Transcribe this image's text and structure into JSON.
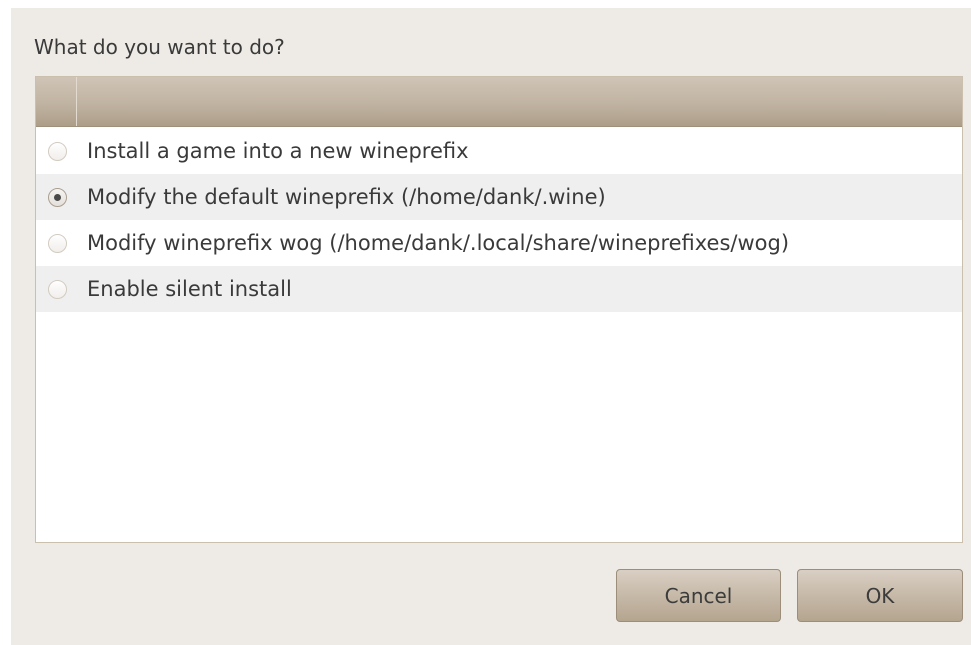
{
  "dialog": {
    "prompt": "What do you want to do?"
  },
  "options": [
    {
      "label": "Install a game into a new wineprefix",
      "selected": false
    },
    {
      "label": "Modify the default wineprefix (/home/dank/.wine)",
      "selected": true
    },
    {
      "label": "Modify wineprefix wog (/home/dank/.local/share/wineprefixes/wog)",
      "selected": false
    },
    {
      "label": "Enable silent install",
      "selected": false
    }
  ],
  "buttons": {
    "cancel_label": "Cancel",
    "ok_label": "OK"
  },
  "colors": {
    "window_background": "#eeebe6",
    "header_gradient_top": "#cfc4b6",
    "header_gradient_bottom": "#ad9e89",
    "alternate_row": "#efefef",
    "button_gradient_top": "#d9cfc3",
    "button_gradient_bottom": "#b4a58f"
  }
}
